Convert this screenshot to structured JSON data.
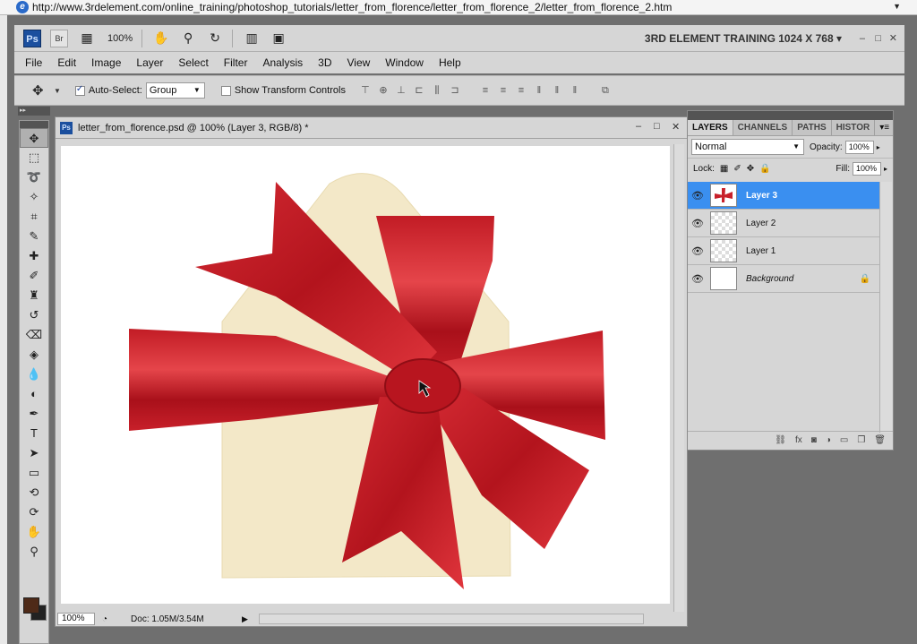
{
  "browser": {
    "url": "http://www.3rdelement.com/online_training/photoshop_tutorials/letter_from_florence/letter_from_florence_2/letter_from_florence_2.htm"
  },
  "appbar": {
    "logo": "Ps",
    "bridge": "Br",
    "zoom": "100%",
    "workspace": "3RD ELEMENT TRAINING 1024 X 768"
  },
  "menu": [
    "File",
    "Edit",
    "Image",
    "Layer",
    "Select",
    "Filter",
    "Analysis",
    "3D",
    "View",
    "Window",
    "Help"
  ],
  "options": {
    "auto_select_label": "Auto-Select:",
    "auto_select_value": "Group",
    "show_transform_label": "Show Transform Controls"
  },
  "document": {
    "title": "letter_from_florence.psd @ 100% (Layer 3, RGB/8) *",
    "zoom": "100%",
    "doc_info": "Doc: 1.05M/3.54M"
  },
  "layers_panel": {
    "tabs": [
      "LAYERS",
      "CHANNELS",
      "PATHS",
      "HISTOR"
    ],
    "blend_mode": "Normal",
    "opacity_label": "Opacity:",
    "opacity": "100%",
    "lock_label": "Lock:",
    "fill_label": "Fill:",
    "fill": "100%",
    "layers": [
      {
        "name": "Layer 3",
        "selected": true
      },
      {
        "name": "Layer 2",
        "selected": false
      },
      {
        "name": "Layer 1",
        "selected": false
      },
      {
        "name": "Background",
        "selected": false
      }
    ]
  },
  "colors": {
    "foreground": "#4e2a18",
    "background": "#222222",
    "ribbon": "#c8202a",
    "envelope": "#f3e8c8",
    "selection": "#3a8ff0"
  }
}
